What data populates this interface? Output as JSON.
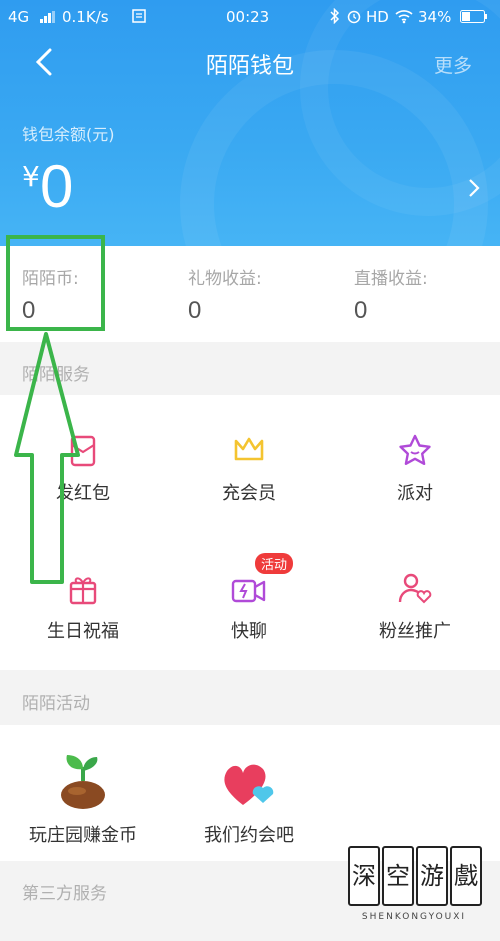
{
  "status_bar": {
    "network": "4G",
    "speed": "0.1K/s",
    "time": "00:23",
    "hd": "HD",
    "battery": "34%"
  },
  "header": {
    "title": "陌陌钱包",
    "more": "更多"
  },
  "balance": {
    "label": "钱包余额(元)",
    "currency": "¥",
    "value": "0"
  },
  "stats": [
    {
      "label": "陌陌币:",
      "value": "0"
    },
    {
      "label": "礼物收益:",
      "value": "0"
    },
    {
      "label": "直播收益:",
      "value": "0"
    }
  ],
  "services": {
    "title": "陌陌服务",
    "items": [
      {
        "label": "发红包",
        "icon": "red-envelope-icon"
      },
      {
        "label": "充会员",
        "icon": "crown-icon"
      },
      {
        "label": "派对",
        "icon": "star-icon"
      },
      {
        "label": "生日祝福",
        "icon": "gift-icon"
      },
      {
        "label": "快聊",
        "icon": "video-call-icon",
        "badge": "活动"
      },
      {
        "label": "粉丝推广",
        "icon": "fans-icon"
      }
    ]
  },
  "activities": {
    "title": "陌陌活动",
    "items": [
      {
        "label": "玩庄园赚金币",
        "icon": "sprout-icon"
      },
      {
        "label": "我们约会吧",
        "icon": "hearts-icon"
      }
    ]
  },
  "third_party": {
    "title": "第三方服务"
  },
  "watermark": {
    "chars": [
      "深",
      "空",
      "游",
      "戲"
    ],
    "text": "SHENKONGYOUXI"
  },
  "colors": {
    "header_blue": "#2f9cf0",
    "annotation_green": "#3bb54a",
    "accent_pink": "#e84a7a",
    "crown_yellow": "#f4c430",
    "party_purple": "#b04ad8"
  }
}
